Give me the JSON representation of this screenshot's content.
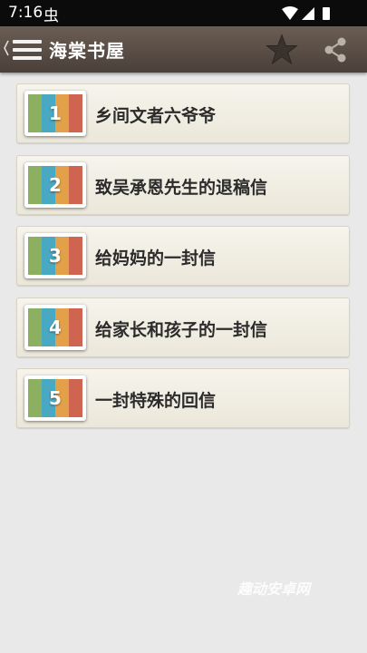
{
  "status": {
    "time": "7:16",
    "app_icon_glyph": "虫"
  },
  "header": {
    "title": "海棠书屋",
    "icons": [
      "back-icon",
      "menu-icon",
      "star-icon",
      "share-icon"
    ]
  },
  "book_colors": [
    "#8db060",
    "#4aa9c2",
    "#e2a048",
    "#cf6550"
  ],
  "items": [
    {
      "number": "1",
      "title": "乡间文者六爷爷"
    },
    {
      "number": "2",
      "title": "致吴承恩先生的退稿信"
    },
    {
      "number": "3",
      "title": "给妈妈的一封信"
    },
    {
      "number": "4",
      "title": "给家长和孩子的一封信"
    },
    {
      "number": "5",
      "title": "一封特殊的回信"
    }
  ],
  "watermark": "趣动安卓网"
}
